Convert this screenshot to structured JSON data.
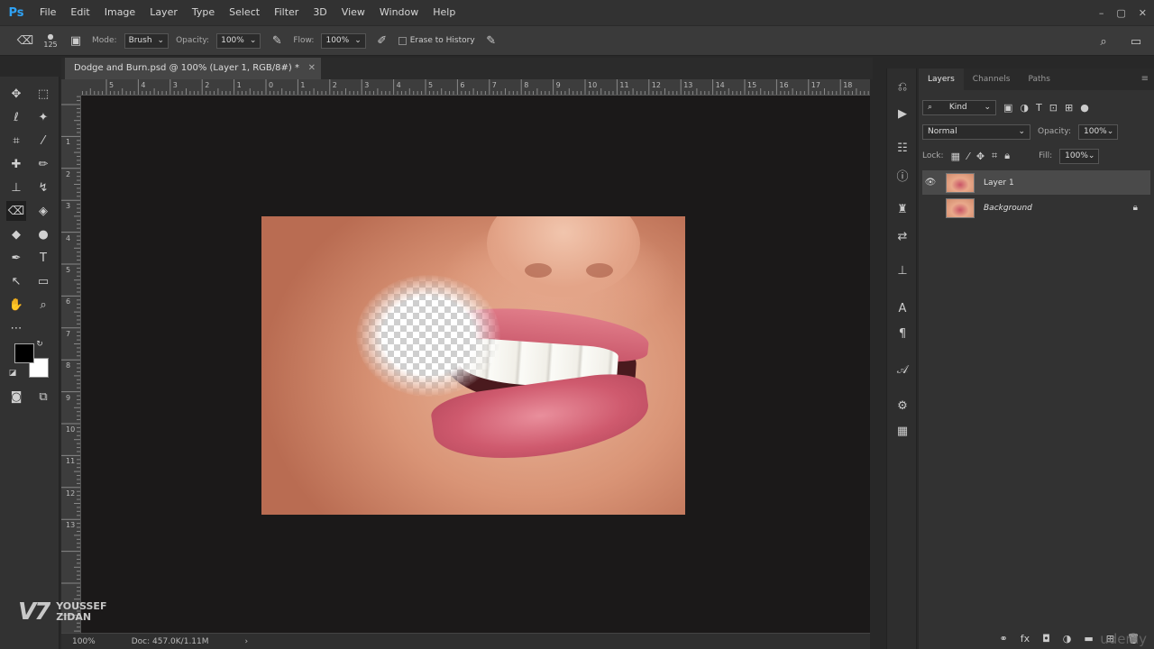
{
  "app": {
    "logo": "Ps"
  },
  "menu": [
    "File",
    "Edit",
    "Image",
    "Layer",
    "Type",
    "Select",
    "Filter",
    "3D",
    "View",
    "Window",
    "Help"
  ],
  "window_controls": [
    "–",
    "▢",
    "✕"
  ],
  "options_bar": {
    "brush_size": "125",
    "mode_label": "Mode:",
    "mode_value": "Brush",
    "opacity_label": "Opacity:",
    "opacity_value": "100%",
    "flow_label": "Flow:",
    "flow_value": "100%",
    "erase_to_history": "Erase to History"
  },
  "document": {
    "tab_title": "Dodge and Burn.psd @ 100% (Layer 1, RGB/8#) *",
    "close": "✕"
  },
  "ruler_top": [
    "5",
    "4",
    "3",
    "2",
    "1",
    "0",
    "1",
    "2",
    "3",
    "4",
    "5",
    "6",
    "7",
    "8",
    "9",
    "10",
    "11",
    "12",
    "13",
    "14",
    "15",
    "16",
    "17",
    "18"
  ],
  "ruler_left": [
    "1",
    "2",
    "3",
    "4",
    "5",
    "6",
    "7",
    "8",
    "9",
    "10",
    "11",
    "12",
    "13"
  ],
  "status": {
    "zoom": "100%",
    "doc": "Doc: 457.0K/1.11M"
  },
  "watermark": {
    "logo": "V7",
    "line1": "YOUSSEF",
    "line2": "ZIDAN"
  },
  "layers_panel": {
    "tabs": [
      "Layers",
      "Channels",
      "Paths"
    ],
    "kind": "Kind",
    "blend_mode": "Normal",
    "opacity_label": "Opacity:",
    "opacity_value": "100%",
    "lock_label": "Lock:",
    "fill_label": "Fill:",
    "fill_value": "100%",
    "layers": [
      {
        "name": "Layer 1",
        "visible": true,
        "selected": true
      },
      {
        "name": "Background",
        "visible": false,
        "locked": true
      }
    ]
  },
  "branding": "udemy"
}
